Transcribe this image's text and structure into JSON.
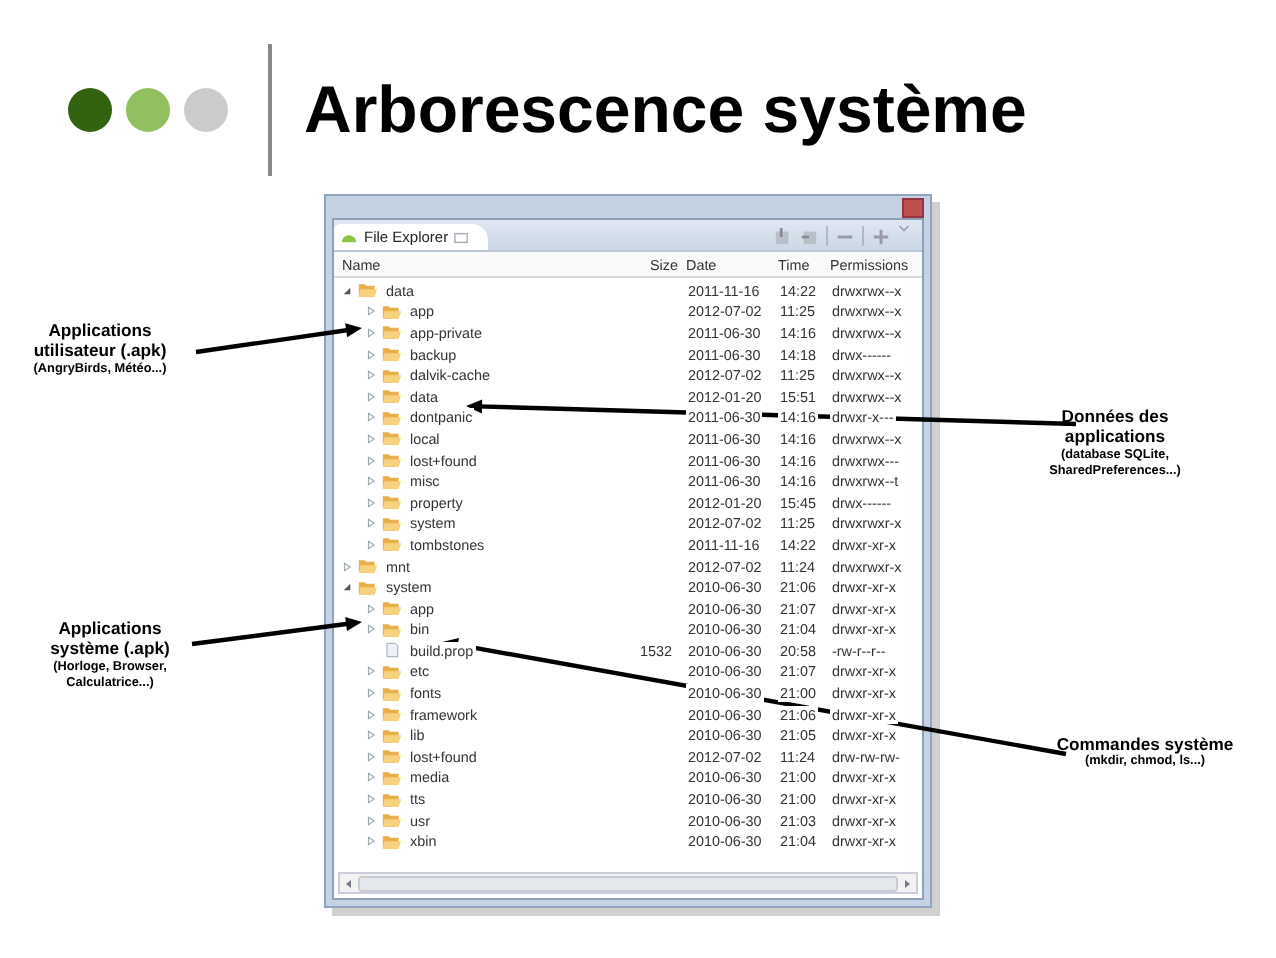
{
  "title": "Arborescence système",
  "explorer": {
    "tab": "File Explorer",
    "columns": [
      "Name",
      "Size",
      "Date",
      "Time",
      "Permissions"
    ],
    "tree": [
      {
        "name": "data",
        "kind": "folder",
        "expanded": true,
        "date": "2011-11-16",
        "time": "14:22",
        "permissions": "drwxrwx--x",
        "children": [
          {
            "name": "app",
            "kind": "folder",
            "expanded": false,
            "date": "2012-07-02",
            "time": "11:25",
            "permissions": "drwxrwx--x"
          },
          {
            "name": "app-private",
            "kind": "folder",
            "expanded": false,
            "date": "2011-06-30",
            "time": "14:16",
            "permissions": "drwxrwx--x"
          },
          {
            "name": "backup",
            "kind": "folder",
            "expanded": false,
            "date": "2011-06-30",
            "time": "14:18",
            "permissions": "drwx------"
          },
          {
            "name": "dalvik-cache",
            "kind": "folder",
            "expanded": false,
            "date": "2012-07-02",
            "time": "11:25",
            "permissions": "drwxrwx--x"
          },
          {
            "name": "data",
            "kind": "folder",
            "expanded": false,
            "date": "2012-01-20",
            "time": "15:51",
            "permissions": "drwxrwx--x"
          },
          {
            "name": "dontpanic",
            "kind": "folder",
            "expanded": false,
            "date": "2011-06-30",
            "time": "14:16",
            "permissions": "drwxr-x---"
          },
          {
            "name": "local",
            "kind": "folder",
            "expanded": false,
            "date": "2011-06-30",
            "time": "14:16",
            "permissions": "drwxrwx--x"
          },
          {
            "name": "lost+found",
            "kind": "folder",
            "expanded": false,
            "date": "2011-06-30",
            "time": "14:16",
            "permissions": "drwxrwx---"
          },
          {
            "name": "misc",
            "kind": "folder",
            "expanded": false,
            "date": "2011-06-30",
            "time": "14:16",
            "permissions": "drwxrwx--t"
          },
          {
            "name": "property",
            "kind": "folder",
            "expanded": false,
            "date": "2012-01-20",
            "time": "15:45",
            "permissions": "drwx------"
          },
          {
            "name": "system",
            "kind": "folder",
            "expanded": false,
            "date": "2012-07-02",
            "time": "11:25",
            "permissions": "drwxrwxr-x"
          },
          {
            "name": "tombstones",
            "kind": "folder",
            "expanded": false,
            "date": "2011-11-16",
            "time": "14:22",
            "permissions": "drwxr-xr-x"
          }
        ]
      },
      {
        "name": "mnt",
        "kind": "folder",
        "expanded": false,
        "date": "2012-07-02",
        "time": "11:24",
        "permissions": "drwxrwxr-x"
      },
      {
        "name": "system",
        "kind": "folder",
        "expanded": true,
        "date": "2010-06-30",
        "time": "21:06",
        "permissions": "drwxr-xr-x",
        "children": [
          {
            "name": "app",
            "kind": "folder",
            "expanded": false,
            "date": "2010-06-30",
            "time": "21:07",
            "permissions": "drwxr-xr-x"
          },
          {
            "name": "bin",
            "kind": "folder",
            "expanded": false,
            "date": "2010-06-30",
            "time": "21:04",
            "permissions": "drwxr-xr-x"
          },
          {
            "name": "build.prop",
            "kind": "file",
            "size": "1532",
            "date": "2010-06-30",
            "time": "20:58",
            "permissions": "-rw-r--r--"
          },
          {
            "name": "etc",
            "kind": "folder",
            "expanded": false,
            "date": "2010-06-30",
            "time": "21:07",
            "permissions": "drwxr-xr-x"
          },
          {
            "name": "fonts",
            "kind": "folder",
            "expanded": false,
            "date": "2010-06-30",
            "time": "21:00",
            "permissions": "drwxr-xr-x"
          },
          {
            "name": "framework",
            "kind": "folder",
            "expanded": false,
            "date": "2010-06-30",
            "time": "21:06",
            "permissions": "drwxr-xr-x"
          },
          {
            "name": "lib",
            "kind": "folder",
            "expanded": false,
            "date": "2010-06-30",
            "time": "21:05",
            "permissions": "drwxr-xr-x"
          },
          {
            "name": "lost+found",
            "kind": "folder",
            "expanded": false,
            "date": "2012-07-02",
            "time": "11:24",
            "permissions": "drw-rw-rw-"
          },
          {
            "name": "media",
            "kind": "folder",
            "expanded": false,
            "date": "2010-06-30",
            "time": "21:00",
            "permissions": "drwxr-xr-x"
          },
          {
            "name": "tts",
            "kind": "folder",
            "expanded": false,
            "date": "2010-06-30",
            "time": "21:00",
            "permissions": "drwxr-xr-x"
          },
          {
            "name": "usr",
            "kind": "folder",
            "expanded": false,
            "date": "2010-06-30",
            "time": "21:03",
            "permissions": "drwxr-xr-x"
          },
          {
            "name": "xbin",
            "kind": "folder",
            "expanded": false,
            "date": "2010-06-30",
            "time": "21:04",
            "permissions": "drwxr-xr-x"
          }
        ]
      }
    ]
  },
  "annotations": [
    {
      "heading": "Applications utilisateur (.apk)",
      "detail": "(AngryBirds, Météo...)"
    },
    {
      "heading": "Applications système (.apk)",
      "detail": "(Horloge, Browser, Calculatrice...)"
    },
    {
      "heading": "Données des applications",
      "detail": "(database SQLite, SharedPreferences...)"
    },
    {
      "heading": "Commandes système",
      "detail": "(mkdir, chmod, ls...)"
    }
  ]
}
